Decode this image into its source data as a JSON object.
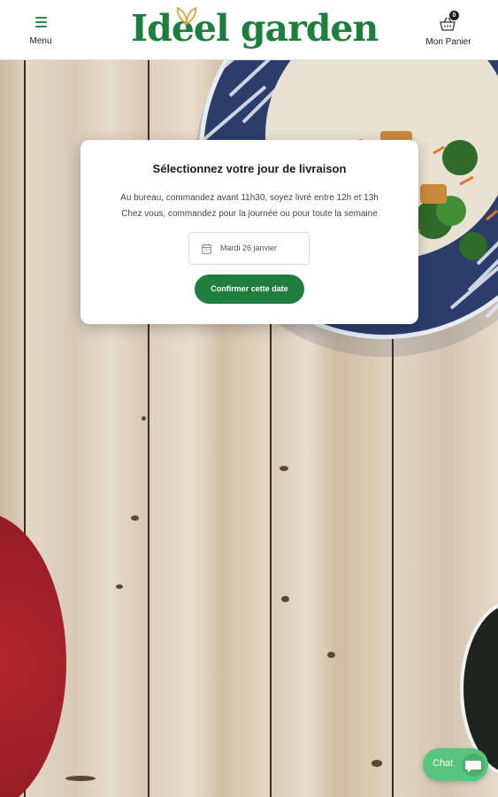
{
  "header": {
    "menu_label": "Menu",
    "logo_text": "Ideel garden",
    "cart_label": "Mon Panier",
    "cart_count": "0"
  },
  "modal": {
    "title": "Sélectionnez votre jour de livraison",
    "line1": "Au bureau, commandez avant 11h30, soyez livré entre 12h et 13h",
    "line2": "Chez vous, commandez pour la journée ou pour toute la semaine",
    "date_value": "Mardi 26 janvier",
    "confirm_label": "Confirmer cette date"
  },
  "chat": {
    "label": "Chat"
  },
  "colors": {
    "brand_green": "#1e7e3e",
    "chat_green": "#58c57c",
    "leaf_gold": "#d9a441"
  },
  "icons": [
    "hamburger-icon",
    "logo-leaf-icon",
    "basket-icon",
    "calendar-icon",
    "chat-bubble-icon"
  ]
}
